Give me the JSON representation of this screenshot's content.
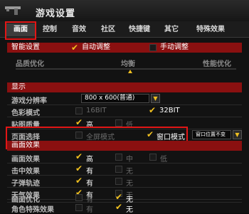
{
  "title": "游戏设置",
  "tabs": [
    "画面",
    "控制",
    "音效",
    "社区",
    "快捷键",
    "其它",
    "特殊效果"
  ],
  "preset": {
    "label": "智能设置",
    "auto": "自动调整",
    "manual": "手动调整",
    "slider_left": "品质优化",
    "slider_mid": "均衡",
    "slider_right": "性能优化"
  },
  "display": {
    "section": "显示",
    "resolution_label": "游戏分辨率",
    "resolution_value": "800 x 600(普通)",
    "color_label": "色彩模式",
    "color_16": "16BIT",
    "color_32": "32BIT",
    "texture_label": "贴图质量",
    "tex_high": "高",
    "tex_low": "低",
    "screen_label": "页面选择",
    "screen_full": "全屏模式",
    "screen_window": "窗口模式",
    "window_pos": "窗口位置不变"
  },
  "effects": {
    "section": "画面效果",
    "rows": [
      {
        "label": "画面效果",
        "o1": "高",
        "o2": "中",
        "o3": "低"
      },
      {
        "label": "击中效果",
        "o1": "有",
        "o2": "无"
      },
      {
        "label": "子弹轨迹",
        "o1": "有",
        "o2": "无"
      },
      {
        "label": "天气效果",
        "o1": "有",
        "o2": "无"
      },
      {
        "label": "画面优化",
        "o1": "有",
        "o2": "无"
      },
      {
        "label": "角色特殊效果",
        "o1": "有",
        "o2": "无"
      }
    ]
  },
  "colors": {
    "accent": "#8a1010",
    "highlight": "#e21616",
    "check": "#f0c020"
  }
}
